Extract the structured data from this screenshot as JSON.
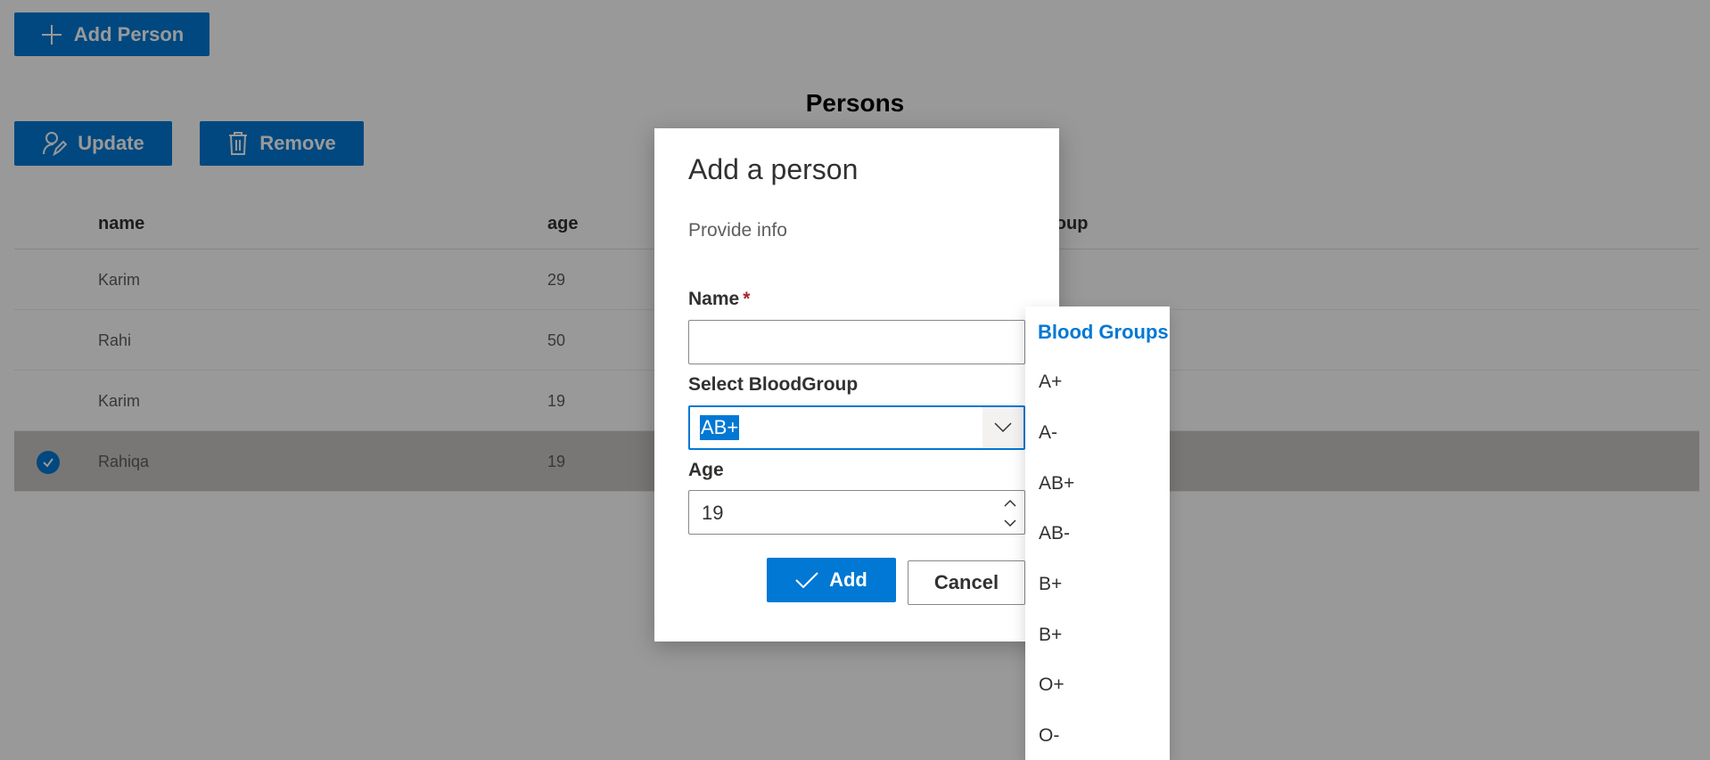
{
  "toolbar": {
    "add_person_label": "Add Person",
    "update_label": "Update",
    "remove_label": "Remove"
  },
  "page": {
    "title": "Persons"
  },
  "table": {
    "columns": [
      "name",
      "age",
      "bloodGroup"
    ],
    "column_visible_fragment": "roup",
    "rows": [
      {
        "name": "Karim",
        "age": "29",
        "selected": false
      },
      {
        "name": "Rahi",
        "age": "50",
        "selected": false
      },
      {
        "name": "Karim",
        "age": "19",
        "selected": false
      },
      {
        "name": "Rahiqa",
        "age": "19",
        "selected": true
      }
    ]
  },
  "dialog": {
    "title": "Add a person",
    "subtitle": "Provide info",
    "name_label": "Name",
    "required_mark": "*",
    "name_value": "",
    "blood_label": "Select BloodGroup",
    "blood_value": "AB+",
    "age_label": "Age",
    "age_value": "19",
    "add_label": "Add",
    "cancel_label": "Cancel"
  },
  "dropdown": {
    "header": "Blood Groups",
    "options": [
      "A+",
      "A-",
      "AB+",
      "AB-",
      "B+",
      "B+",
      "O+",
      "O-"
    ]
  },
  "icons": {
    "add": "plus-icon",
    "update": "edit-person-icon",
    "remove": "trash-icon",
    "check": "checkmark-circle-icon",
    "caret": "chevron-down-icon",
    "spin_up": "chevron-up-icon",
    "spin_down": "chevron-down-icon",
    "accept": "checkmark-icon"
  },
  "colors": {
    "primary": "#0078d4",
    "overlay": "rgba(0,0,0,0.4)",
    "required": "#a4262c"
  }
}
